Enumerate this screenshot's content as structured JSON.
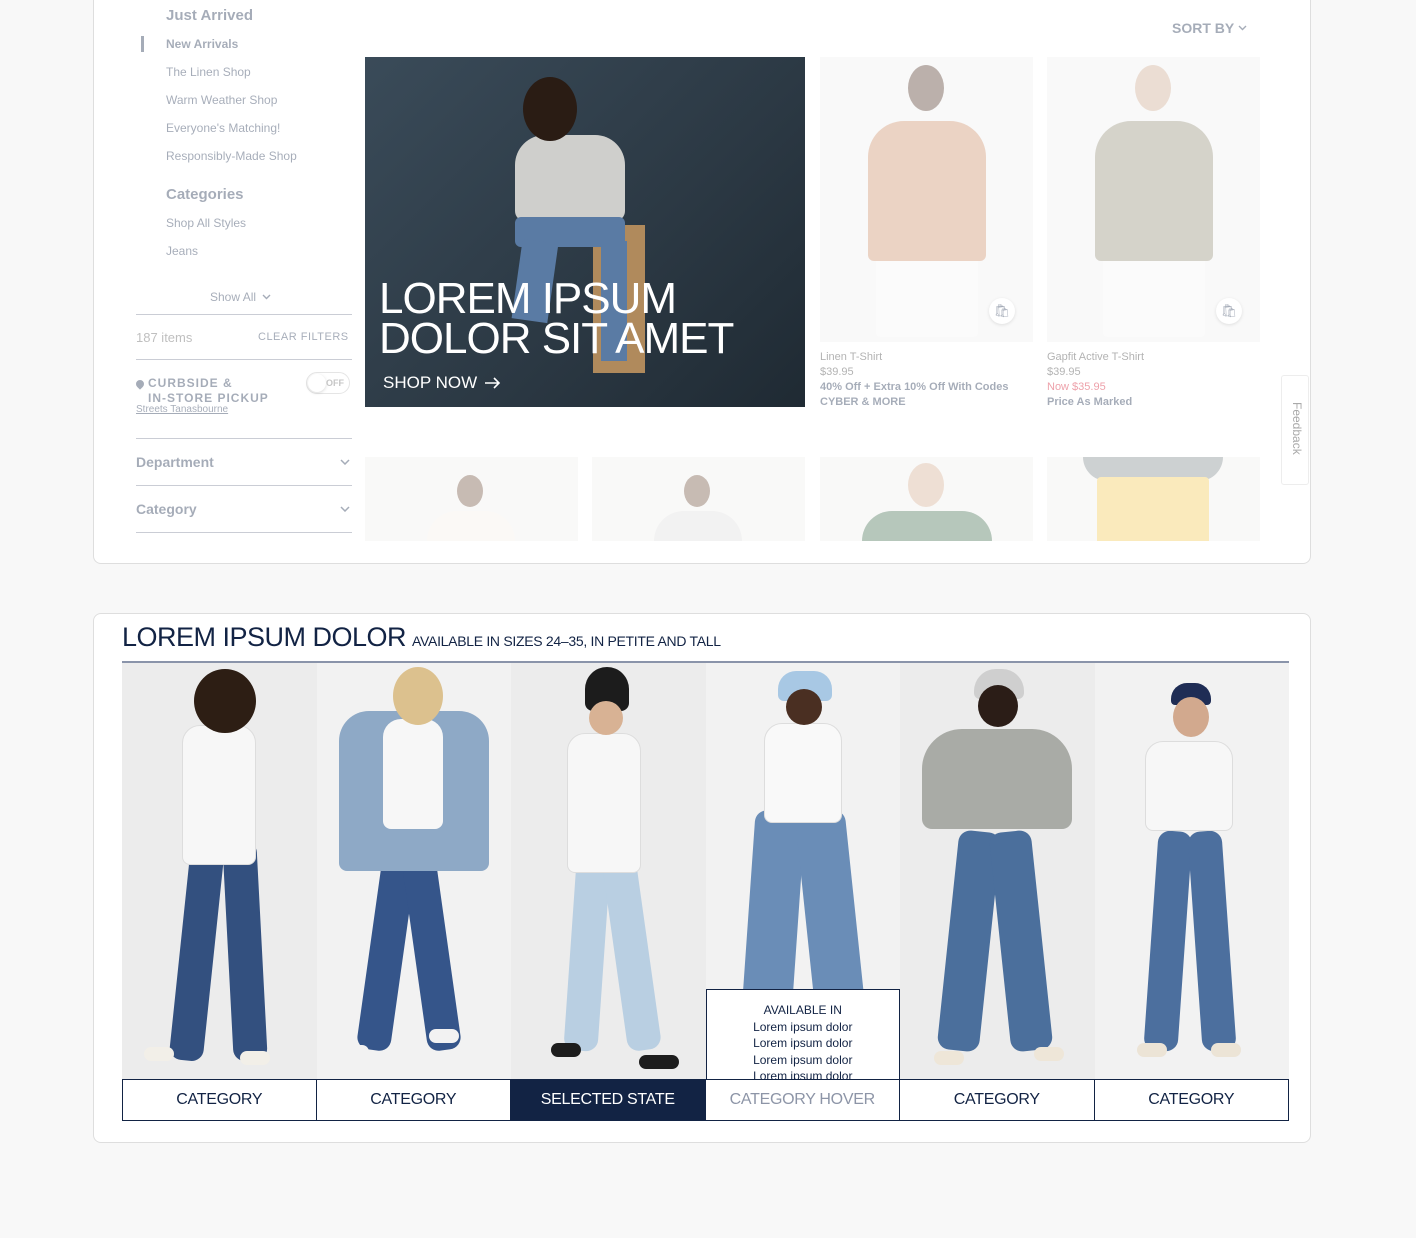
{
  "sidebar": {
    "just_arrived_heading": "Just Arrived",
    "just_arrived_links": [
      "New Arrivals",
      "The Linen Shop",
      "Warm Weather Shop",
      "Everyone's Matching!",
      "Responsibly-Made Shop"
    ],
    "categories_heading": "Categories",
    "category_links": [
      "Shop All Styles",
      "Jeans"
    ],
    "show_all": "Show All",
    "items_count": "187 items",
    "clear_filters": "CLEAR FILTERS",
    "pickup_label_line1": "CURBSIDE &",
    "pickup_label_line2": "IN-STORE PICKUP",
    "pickup_toggle": "OFF",
    "store_link": "Streets Tanasbourne",
    "facets": [
      "Department",
      "Category"
    ]
  },
  "sort_by": "SORT BY",
  "hero": {
    "title_line1": "LOREM IPSUM",
    "title_line2": "DOLOR SIT AMET",
    "cta": "SHOP NOW"
  },
  "products": [
    {
      "name": "Linen T-Shirt",
      "price": "$39.95",
      "promo_line1": "40% Off + Extra 10% Off With Codes",
      "promo_line2": "CYBER & MORE",
      "color": "#c98a64"
    },
    {
      "name": "Gapfit Active T-Shirt",
      "price": "$39.95",
      "sale": "Now $35.95",
      "promo_line1": "Price As Marked",
      "color": "#8f8a74"
    }
  ],
  "feedback": "Feedback",
  "category_section": {
    "title": "LOREM IPSUM DOLOR",
    "subtitle": "AVAILABLE IN SIZES 24–35, IN PETITE AND TALL",
    "tiles": [
      {
        "label": "CATEGORY",
        "state": "default"
      },
      {
        "label": "CATEGORY",
        "state": "default"
      },
      {
        "label": "SELECTED STATE",
        "state": "selected"
      },
      {
        "label": "CATEGORY HOVER",
        "state": "hover"
      },
      {
        "label": "CATEGORY",
        "state": "default"
      },
      {
        "label": "CATEGORY",
        "state": "default"
      }
    ],
    "hover_panel": {
      "heading": "AVAILABLE IN",
      "lines": [
        "Lorem ipsum dolor",
        "Lorem ipsum dolor",
        "Lorem ipsum dolor",
        "Lorem ipsum dolor"
      ]
    }
  },
  "colors": {
    "navy": "#122344",
    "sale_red": "#d0021b"
  }
}
